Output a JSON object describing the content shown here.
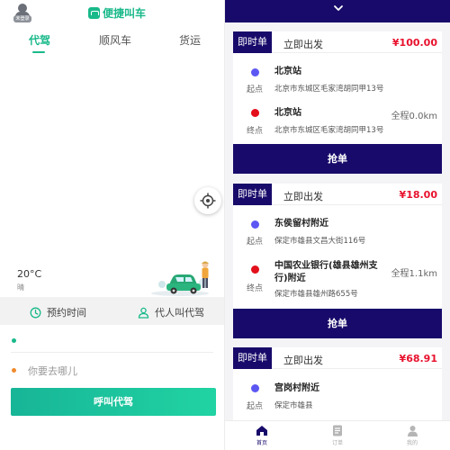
{
  "driver_app": {
    "avatar_tag": "未登录",
    "brand": "便捷叫车",
    "tabs": [
      {
        "label": "代驾",
        "active": true
      },
      {
        "label": "顺风车",
        "active": false
      },
      {
        "label": "货运",
        "active": false
      }
    ],
    "weather": {
      "temp": "20°C",
      "condition": "晴"
    },
    "options": [
      {
        "label": "预约时间",
        "icon": "clock-icon"
      },
      {
        "label": "代人叫代驾",
        "icon": "person-icon"
      }
    ],
    "start_value": "",
    "destination_placeholder": "你要去哪儿",
    "call_button": "呼叫代驾",
    "colors": {
      "accent": "#19b98a",
      "start_dot": "#19b98a",
      "end_dot": "#f08a2c"
    }
  },
  "orders_app": {
    "collapse_icon": "chevron-down-icon",
    "orders": [
      {
        "type": "即时单",
        "depart": "立即出发",
        "price": "¥100.00",
        "start_label": "起点",
        "start_name": "北京站",
        "start_addr": "北京市东城区毛家湾胡同甲13号",
        "end_label": "终点",
        "end_name": "北京站",
        "end_addr": "北京市东城区毛家湾胡同甲13号",
        "distance": "全程0.0km",
        "action": "抢单"
      },
      {
        "type": "即时单",
        "depart": "立即出发",
        "price": "¥18.00",
        "start_label": "起点",
        "start_name": "东侯留村附近",
        "start_addr": "保定市雄县文昌大街116号",
        "end_label": "终点",
        "end_name_1": "中国农业银行(雄县雄州支",
        "end_name_2": "行)附近",
        "end_addr": "保定市雄县雄州路655号",
        "distance": "全程1.1km",
        "action": "抢单"
      },
      {
        "type": "即时单",
        "depart": "立即出发",
        "price": "¥68.91",
        "start_label": "起点",
        "start_name": "宫岗村附近",
        "start_addr": "保定市雄县"
      }
    ],
    "nav": [
      {
        "label": "首页",
        "icon": "home-icon",
        "active": true
      },
      {
        "label": "订单",
        "icon": "order-icon",
        "active": false
      },
      {
        "label": "我的",
        "icon": "profile-icon",
        "active": false
      }
    ],
    "colors": {
      "primary": "#170a6a",
      "price": "#e8112d",
      "start_dot": "#5c57f2",
      "end_dot": "#e30f1b"
    }
  }
}
